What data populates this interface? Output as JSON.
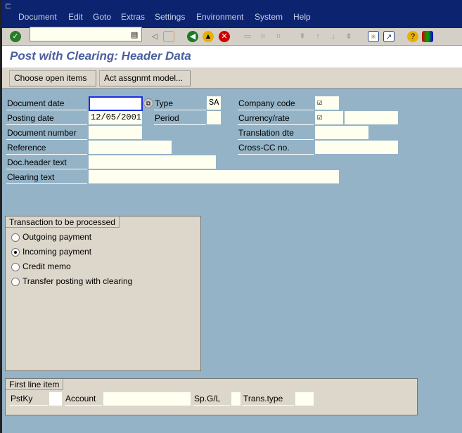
{
  "menu": [
    "Document",
    "Edit",
    "Goto",
    "Extras",
    "Settings",
    "Environment",
    "System",
    "Help"
  ],
  "toolbar": {
    "command_value": "",
    "icons": [
      "enter-icon",
      "save-icon",
      "back-icon",
      "exit-icon",
      "cancel-icon",
      "print-icon",
      "find-icon",
      "find-next-icon",
      "first-page-icon",
      "previous-page-icon",
      "next-page-icon",
      "last-page-icon",
      "create-session-icon",
      "shortcut-icon",
      "help-icon",
      "layout-menu-icon"
    ]
  },
  "page_title": "Post with Clearing: Header Data",
  "buttons": {
    "choose_open_items": "Choose open items",
    "act_assgnmt_model": "Act assgnmt model..."
  },
  "header": {
    "document_date": {
      "label": "Document date",
      "value": ""
    },
    "type": {
      "label": "Type",
      "value": "SA"
    },
    "company_code": {
      "label": "Company code",
      "value": "☑"
    },
    "posting_date": {
      "label": "Posting date",
      "value": "12/05/2001"
    },
    "period": {
      "label": "Period",
      "value": ""
    },
    "currency_rate": {
      "label": "Currency/rate",
      "value": "☑",
      "rate": ""
    },
    "document_number": {
      "label": "Document number",
      "value": ""
    },
    "translation_dte": {
      "label": "Translation dte",
      "value": ""
    },
    "reference": {
      "label": "Reference",
      "value": ""
    },
    "cross_cc_no": {
      "label": "Cross-CC no.",
      "value": ""
    },
    "doc_header_text": {
      "label": "Doc.header text",
      "value": ""
    },
    "clearing_text": {
      "label": "Clearing text",
      "value": ""
    }
  },
  "transaction": {
    "title": "Transaction to be processed",
    "options": [
      "Outgoing payment",
      "Incoming payment",
      "Credit memo",
      "Transfer posting with clearing"
    ],
    "selected": "Incoming payment"
  },
  "first_line_item": {
    "title": "First line item",
    "pstky": {
      "label": "PstKy",
      "value": ""
    },
    "account": {
      "label": "Account",
      "value": ""
    },
    "spgl": {
      "label": "Sp.G/L",
      "value": ""
    },
    "trans_type": {
      "label": "Trans.type",
      "value": ""
    }
  }
}
